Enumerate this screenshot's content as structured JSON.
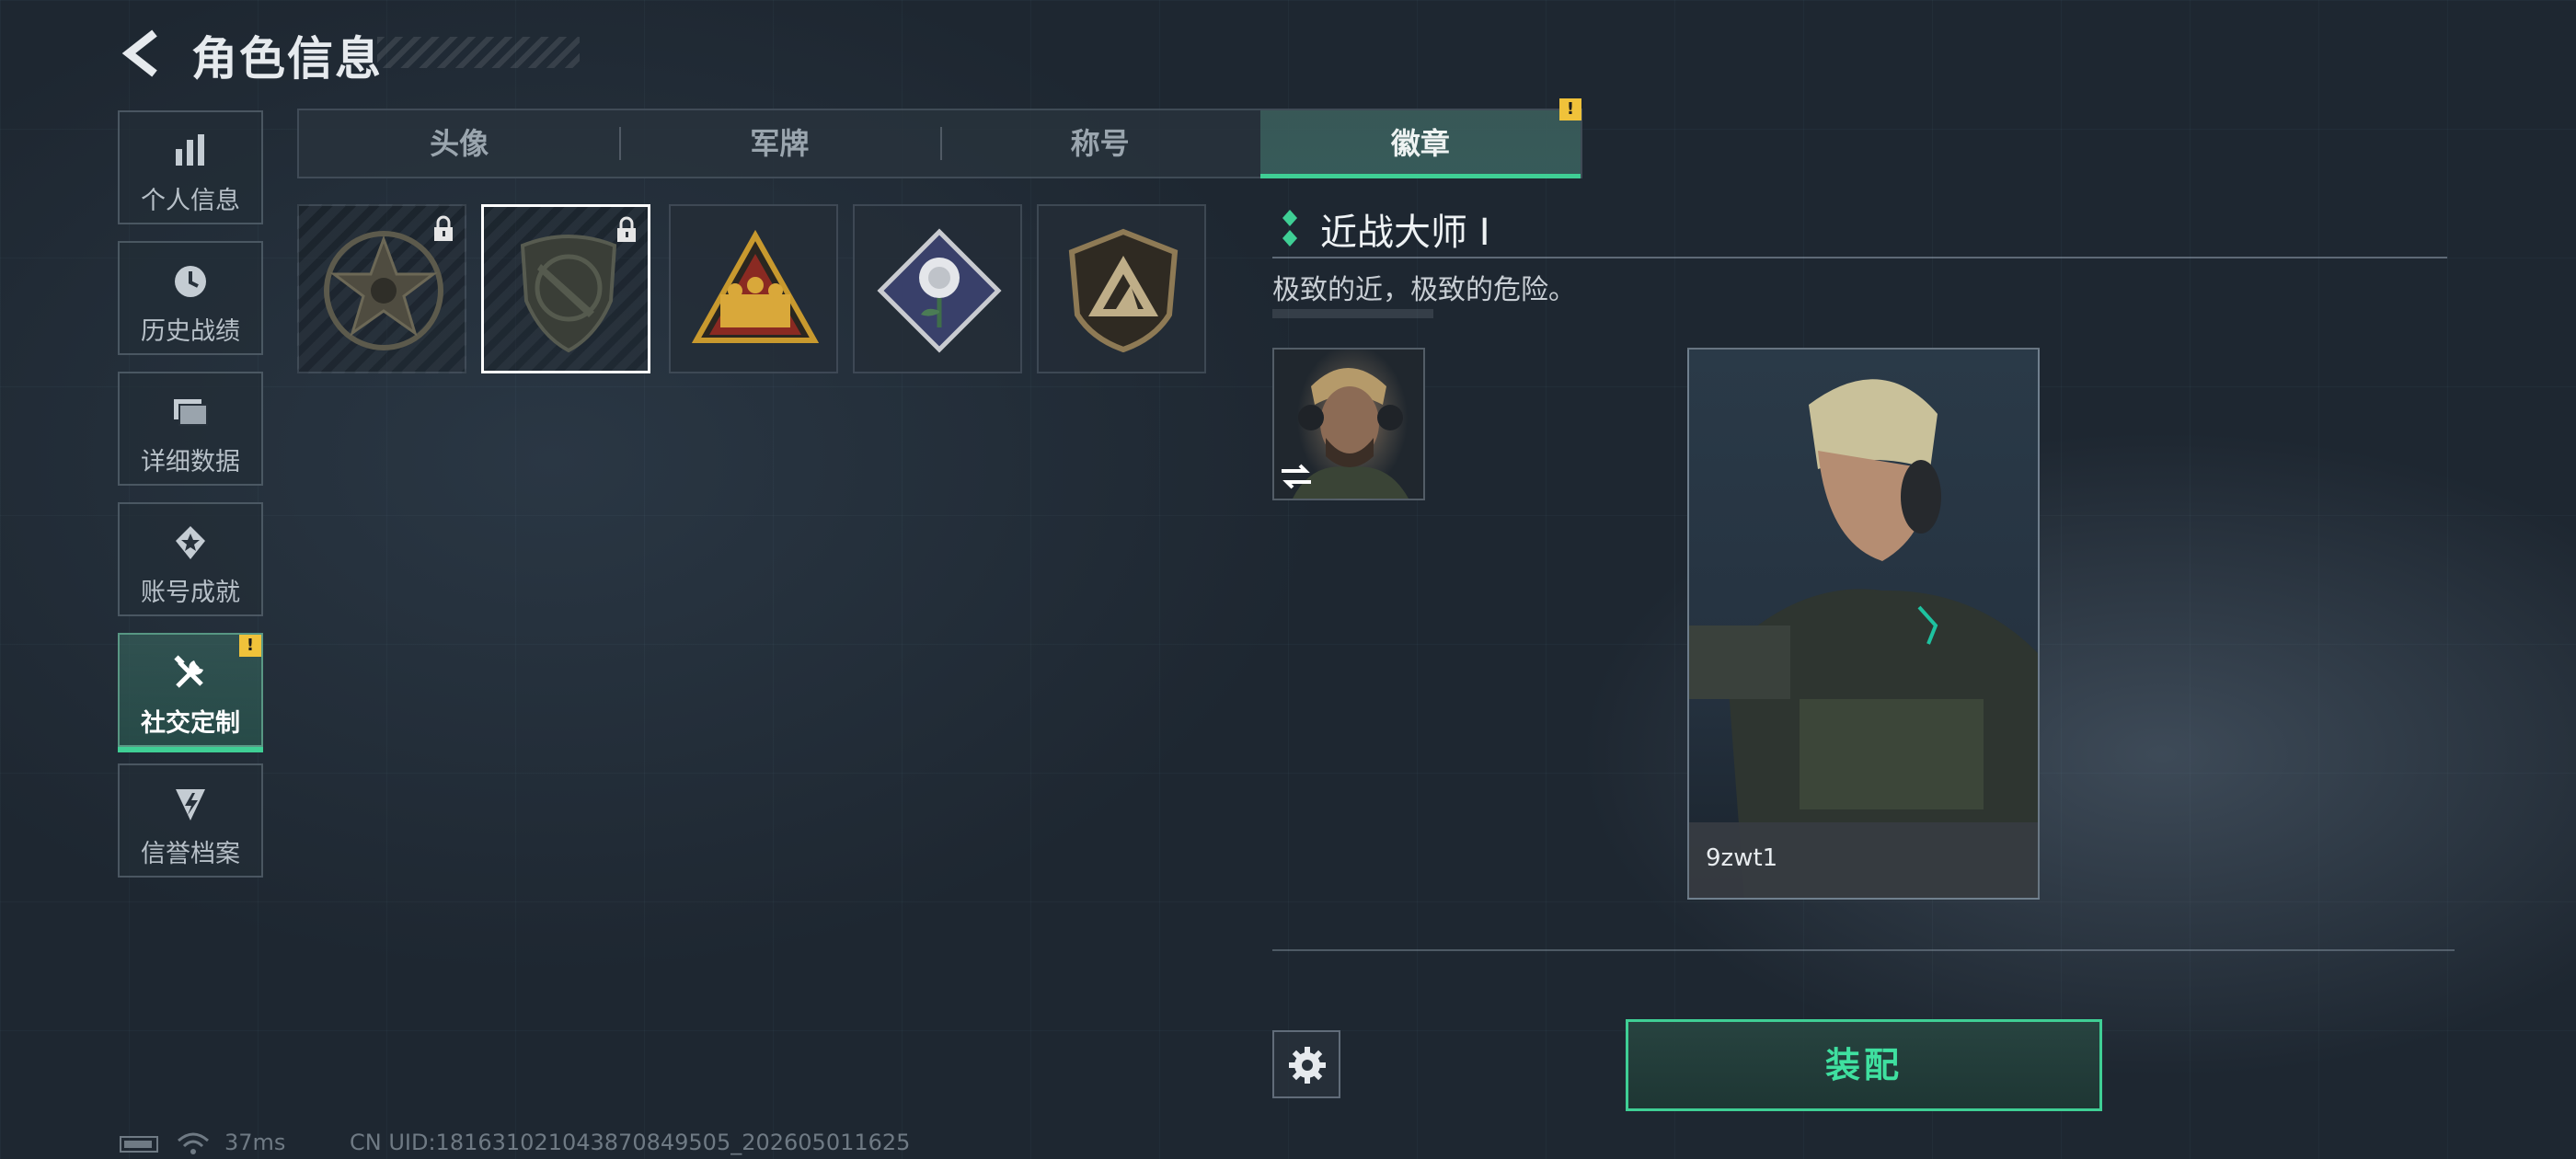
{
  "header": {
    "title": "角色信息"
  },
  "sidebar": {
    "items": [
      {
        "label": "个人信息",
        "icon": "bar-chart-icon"
      },
      {
        "label": "历史战绩",
        "icon": "history-clock-icon"
      },
      {
        "label": "详细数据",
        "icon": "folder-icon"
      },
      {
        "label": "账号成就",
        "icon": "achievement-icon"
      },
      {
        "label": "社交定制",
        "icon": "tools-icon",
        "active": true,
        "alert": "!"
      },
      {
        "label": "信誉档案",
        "icon": "credit-shield-icon"
      }
    ]
  },
  "tabs": [
    {
      "label": "头像"
    },
    {
      "label": "军牌"
    },
    {
      "label": "称号"
    },
    {
      "label": "徽章",
      "active": true,
      "alert": "!"
    }
  ],
  "badges": [
    {
      "name": "star-skull-badge",
      "locked": true
    },
    {
      "name": "knife-shield-badge",
      "locked": true,
      "selected": true
    },
    {
      "name": "squad-triangle-badge",
      "locked": false
    },
    {
      "name": "rose-diamond-badge",
      "locked": false
    },
    {
      "name": "mountain-shield-badge",
      "locked": false
    }
  ],
  "detail": {
    "name": "近战大师 I",
    "description": "极致的近，极致的危险。"
  },
  "card": {
    "player_name": "9zwt1"
  },
  "actions": {
    "equip_label": "装配"
  },
  "status": {
    "ping": "37ms",
    "uid": "CN UID:181631021043870849505_202605011625"
  },
  "colors": {
    "accent": "#3fcf95",
    "alert": "#f0c23a"
  }
}
